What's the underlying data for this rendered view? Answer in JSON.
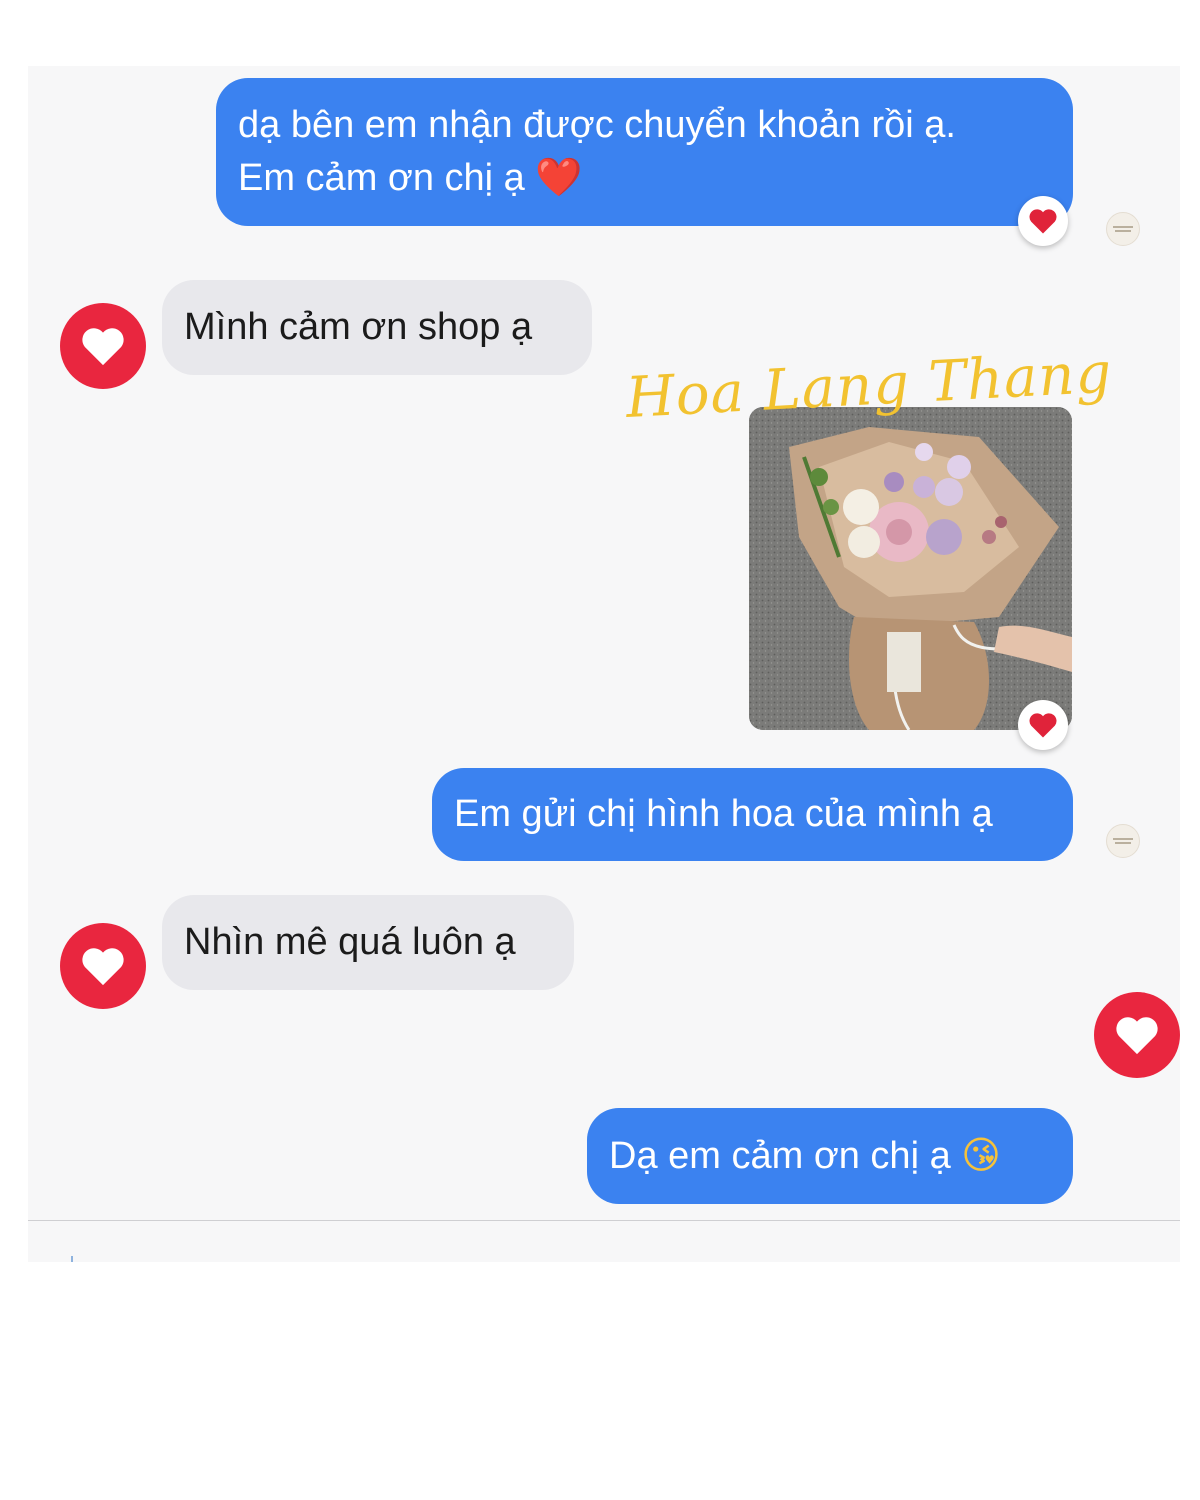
{
  "messages": [
    {
      "id": "m1",
      "side": "sent",
      "lines": [
        "dạ bên em nhận được chuyển khoản rồi ạ.",
        "Em cảm ơn chị ạ"
      ],
      "emoji": "❤️",
      "reaction": "❤️"
    },
    {
      "id": "m2",
      "side": "received",
      "text": "Mình cảm ơn shop ạ"
    },
    {
      "id": "m3",
      "side": "sent",
      "type": "image",
      "image_desc": "flower-bouquet-photo",
      "watermark": "Hoa Lang Thang",
      "reaction": "❤️"
    },
    {
      "id": "m4",
      "side": "sent",
      "text": "Em gửi chị hình hoa của mình ạ"
    },
    {
      "id": "m5",
      "side": "received",
      "text": "Nhìn mê quá luôn ạ"
    },
    {
      "id": "m6",
      "side": "sent",
      "text": "Dạ em cảm ơn chị ạ",
      "emoji": "😘"
    }
  ],
  "icons": {
    "avatar": "heart-icon",
    "reaction": "red-heart-emoji",
    "seen_receipt": "shop-logo-icon"
  },
  "colors": {
    "sent_bubble": "#3b82f0",
    "received_bubble": "#e8e8ec",
    "heart_avatar": "#e9263f",
    "watermark": "#f2c230",
    "chat_background": "#f7f7f8"
  }
}
